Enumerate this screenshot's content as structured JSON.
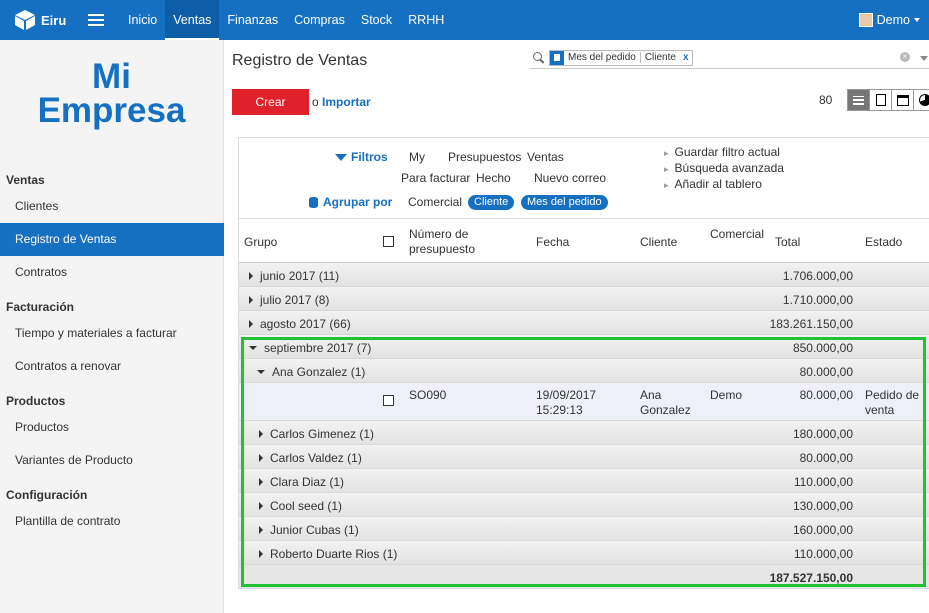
{
  "app": {
    "name": "Eiru"
  },
  "topnav": {
    "items": [
      "Inicio",
      "Ventas",
      "Finanzas",
      "Compras",
      "Stock",
      "RRHH"
    ],
    "active": "Ventas"
  },
  "user": {
    "name": "Demo"
  },
  "sidebar": {
    "company_line1": "Mi",
    "company_line2": "Empresa",
    "sections": [
      {
        "title": "Ventas",
        "items": [
          "Clientes",
          "Registro de Ventas",
          "Contratos"
        ]
      },
      {
        "title": "Facturación",
        "items": [
          "Tiempo y materiales a facturar",
          "Contratos a renovar"
        ]
      },
      {
        "title": "Productos",
        "items": [
          "Productos",
          "Variantes de Producto"
        ]
      },
      {
        "title": "Configuración",
        "items": [
          "Plantilla de contrato"
        ]
      }
    ],
    "active_item": "Registro de Ventas"
  },
  "page": {
    "title": "Registro de Ventas"
  },
  "search": {
    "facet_groups": [
      "Mes del pedido",
      "Cliente"
    ],
    "remove_label": "x"
  },
  "actions": {
    "create_label": "Crear",
    "or_label": "o",
    "import_label": "Importar",
    "record_count": "80"
  },
  "filters": {
    "filters_label": "Filtros",
    "groupby_label": "Agrupar por",
    "filter_options": [
      "My",
      "Presupuestos",
      "Ventas",
      "Para facturar",
      "Hecho",
      "Nuevo correo"
    ],
    "groupby_options": [
      "Comercial"
    ],
    "active_groupby": [
      "Cliente",
      "Mes del pedido"
    ],
    "favorites": [
      "Guardar filtro actual",
      "Búsqueda avanzada",
      "Añadir al tablero"
    ]
  },
  "table": {
    "columns": {
      "group": "Grupo",
      "number": "Número de presupuesto",
      "date": "Fecha",
      "client": "Cliente",
      "salesperson": "Comercial",
      "total": "Total",
      "state": "Estado"
    },
    "groups_top": [
      {
        "label": "junio 2017 (11)",
        "total": "1.706.000,00"
      },
      {
        "label": "julio 2017 (8)",
        "total": "1.710.000,00"
      },
      {
        "label": "agosto 2017 (66)",
        "total": "183.261.150,00"
      }
    ],
    "open_group": {
      "label": "septiembre 2017 (7)",
      "total": "850.000,00"
    },
    "open_subgroup": {
      "label": "Ana Gonzalez (1)",
      "total": "80.000,00"
    },
    "record": {
      "number": "SO090",
      "date_line1": "19/09/2017",
      "date_line2": "15:29:13",
      "client_line1": "Ana",
      "client_line2": "Gonzalez",
      "salesperson": "Demo",
      "total": "80.000,00",
      "state_line1": "Pedido de",
      "state_line2": "venta"
    },
    "subgroups": [
      {
        "label": "Carlos Gimenez (1)",
        "total": "180.000,00"
      },
      {
        "label": "Carlos Valdez (1)",
        "total": "80.000,00"
      },
      {
        "label": "Clara Diaz (1)",
        "total": "110.000,00"
      },
      {
        "label": "Cool seed (1)",
        "total": "130.000,00"
      },
      {
        "label": "Junior Cubas (1)",
        "total": "160.000,00"
      },
      {
        "label": "Roberto Duarte Rios (1)",
        "total": "110.000,00"
      }
    ],
    "grand_total": "187.527.150,00"
  },
  "colors": {
    "brand": "#1670c2",
    "create": "#e0202a",
    "highlight": "#22c035"
  },
  "icons": [
    "cube-logo-icon",
    "hamburger-icon",
    "search-icon",
    "filter-icon",
    "database-icon",
    "list-view-icon",
    "form-view-icon",
    "calendar-view-icon",
    "graph-view-icon"
  ]
}
